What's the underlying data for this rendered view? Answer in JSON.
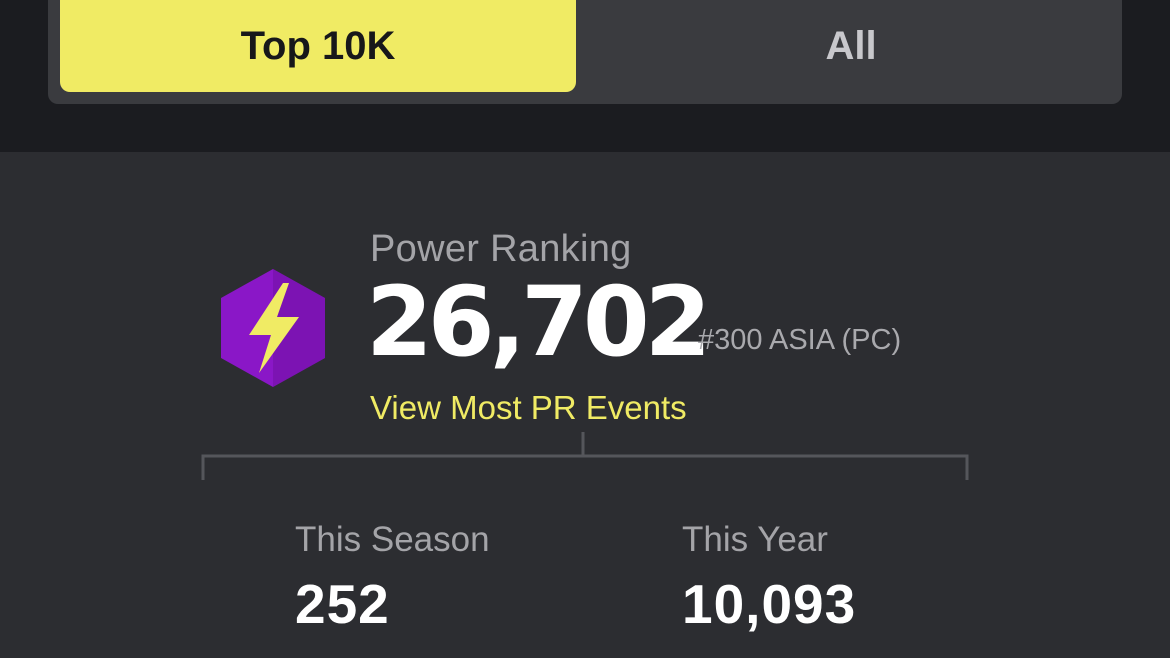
{
  "tabs": {
    "items": [
      {
        "label": "Top 10K",
        "active": true
      },
      {
        "label": "All",
        "active": false
      }
    ],
    "active_color": "#f0eb64"
  },
  "power_ranking": {
    "title": "Power Ranking",
    "value": "26,702",
    "regional_rank": "#300 ASIA (PC)",
    "events_link": "View Most PR Events",
    "badge_icon": "lightning-bolt-hexagon-icon",
    "badge_color": "#8a17c7",
    "accent_color": "#f0eb64"
  },
  "stats": [
    {
      "label": "This Season",
      "value": "252"
    },
    {
      "label": "This Year",
      "value": "10,093"
    }
  ]
}
